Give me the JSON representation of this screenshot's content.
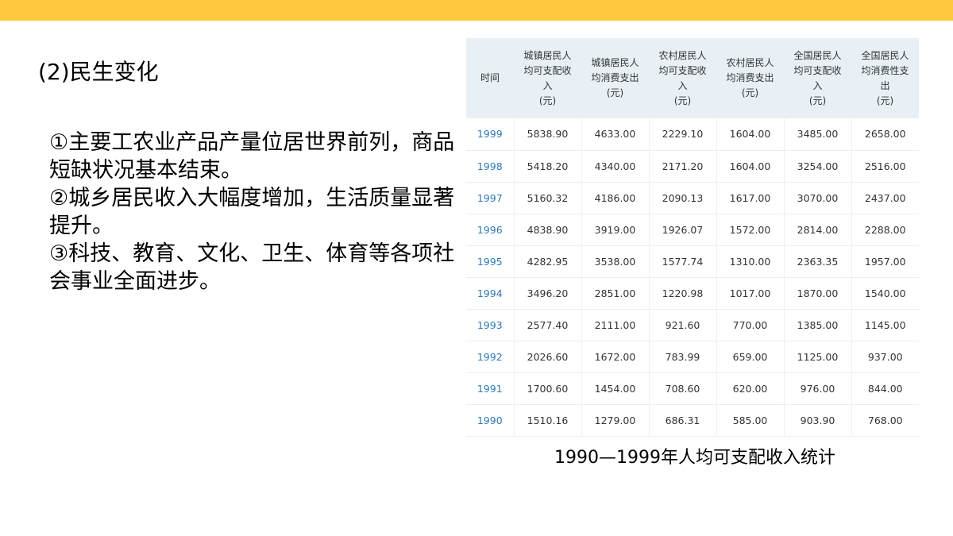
{
  "colors": {
    "top_bar": "#FFC83D",
    "table_header_bg": "#E8EFF5",
    "year_link": "#2E78B7"
  },
  "slide": {
    "heading": "(2)民生变化",
    "points": [
      "①主要工农业产品产量位居世界前列，商品短缺状况基本结束。",
      "②城乡居民收入大幅度增加，生活质量显著提升。",
      "③科技、教育、文化、卫生、体育等各项社会事业全面进步。"
    ],
    "caption": "1990—1999年人均可支配收入统计"
  },
  "table": {
    "headers": [
      "时间",
      "城镇居民人\n均可支配收\n入\n(元)",
      "城镇居民人\n均消费支出\n(元)",
      "农村居民人\n均可支配收\n入\n(元)",
      "农村居民人\n均消费支出\n(元)",
      "全国居民人\n均可支配收\n入\n(元)",
      "全国居民人\n均消费性支\n出\n(元)"
    ],
    "rows": [
      [
        "1999",
        "5838.90",
        "4633.00",
        "2229.10",
        "1604.00",
        "3485.00",
        "2658.00"
      ],
      [
        "1998",
        "5418.20",
        "4340.00",
        "2171.20",
        "1604.00",
        "3254.00",
        "2516.00"
      ],
      [
        "1997",
        "5160.32",
        "4186.00",
        "2090.13",
        "1617.00",
        "3070.00",
        "2437.00"
      ],
      [
        "1996",
        "4838.90",
        "3919.00",
        "1926.07",
        "1572.00",
        "2814.00",
        "2288.00"
      ],
      [
        "1995",
        "4282.95",
        "3538.00",
        "1577.74",
        "1310.00",
        "2363.35",
        "1957.00"
      ],
      [
        "1994",
        "3496.20",
        "2851.00",
        "1220.98",
        "1017.00",
        "1870.00",
        "1540.00"
      ],
      [
        "1993",
        "2577.40",
        "2111.00",
        "921.60",
        "770.00",
        "1385.00",
        "1145.00"
      ],
      [
        "1992",
        "2026.60",
        "1672.00",
        "783.99",
        "659.00",
        "1125.00",
        "937.00"
      ],
      [
        "1991",
        "1700.60",
        "1454.00",
        "708.60",
        "620.00",
        "976.00",
        "844.00"
      ],
      [
        "1990",
        "1510.16",
        "1279.00",
        "686.31",
        "585.00",
        "903.90",
        "768.00"
      ]
    ]
  }
}
